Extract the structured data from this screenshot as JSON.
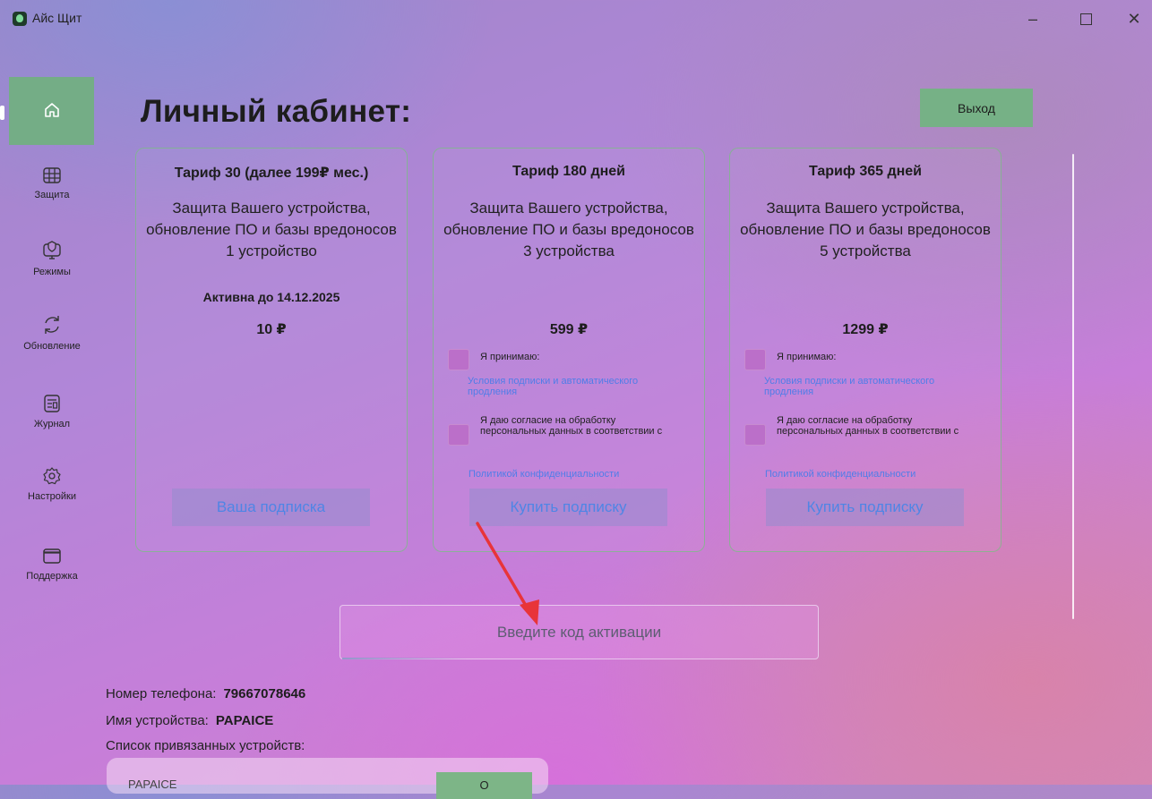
{
  "window": {
    "title": "Айс Щит",
    "controls": {
      "minimize": "–",
      "close": "✕"
    }
  },
  "sidebar": {
    "items": [
      {
        "label": "",
        "icon": "home-icon",
        "active": true
      },
      {
        "label": "Защита",
        "icon": "grid-icon"
      },
      {
        "label": "Режимы",
        "icon": "monitor-shield-icon"
      },
      {
        "label": "Обновление",
        "icon": "refresh-icon"
      },
      {
        "label": "Журнал",
        "icon": "journal-icon"
      },
      {
        "label": "Настройки",
        "icon": "gear-icon"
      },
      {
        "label": "Поддержка",
        "icon": "window-icon"
      }
    ]
  },
  "header": {
    "title": "Личный кабинет:",
    "exit_label": "Выход"
  },
  "tariffs": [
    {
      "title": "Тариф 30 (далее 199₽ мес.)",
      "description": "Защита Вашего устройства, обновление ПО и базы вредоносов 1 устройство",
      "active_until": "Активна до 14.12.2025",
      "price": "10 ₽",
      "button_label": "Ваша подписка"
    },
    {
      "title": "Тариф 180 дней",
      "description": "Защита Вашего устройства, обновление ПО и базы вредоносов 3 устройства",
      "price": "599 ₽",
      "accept_label": "Я принимаю:",
      "terms_link": "Условия подписки и автоматического продления",
      "consent_label": "Я даю согласие на обработку персональных данных в соответствии с",
      "privacy_link": "Политикой конфиденциальности",
      "button_label": "Купить подписку"
    },
    {
      "title": "Тариф 365 дней",
      "description": "Защита Вашего устройства, обновление ПО и базы вредоносов 5 устройства",
      "price": "1299 ₽",
      "accept_label": "Я принимаю:",
      "terms_link": "Условия подписки и автоматического продления",
      "consent_label": "Я даю согласие на обработку персональных данных в соответствии с",
      "privacy_link": "Политикой конфиденциальности",
      "button_label": "Купить подписку"
    }
  ],
  "activation": {
    "placeholder": "Введите код активации"
  },
  "account": {
    "phone_label": "Номер телефона:",
    "phone_value": "79667078646",
    "device_label": "Имя устройства:",
    "device_value": "PAPAICE",
    "devices_list_label": "Список привязанных устройств:",
    "devices": [
      {
        "name": "PAPAICE",
        "button_label": "О"
      }
    ]
  },
  "colors": {
    "accent_green": "#74ad86",
    "link_blue": "#4f7de8",
    "annotation_arrow": "#e8343a"
  }
}
